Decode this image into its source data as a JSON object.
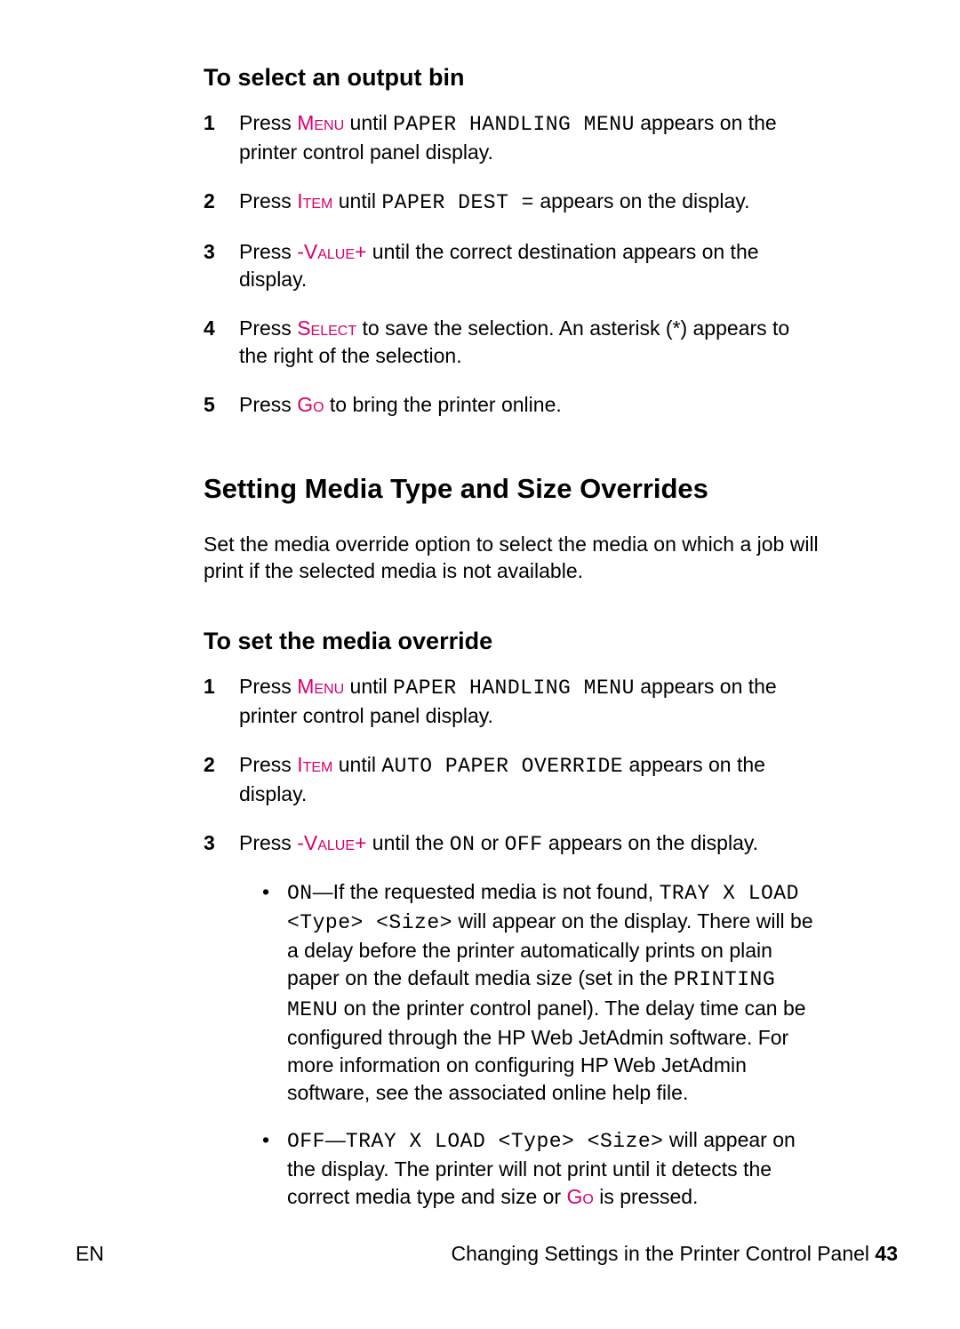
{
  "h_output_bin": "To select an output bin",
  "s1a_pre": "Press ",
  "s1a_key": "Menu",
  "s1a_mid": " until ",
  "s1a_lcd": "PAPER HANDLING MENU",
  "s1a_post": " appears on the printer control panel display.",
  "s2a_pre": "Press ",
  "s2a_key": "Item",
  "s2a_mid": " until ",
  "s2a_lcd": "PAPER DEST =",
  "s2a_post": " appears on the display.",
  "s3a_pre": "Press ",
  "s3a_key": "-Value+",
  "s3a_post": " until the correct destination appears on the display.",
  "s4a_pre": "Press ",
  "s4a_key": "Select",
  "s4a_post": " to save the selection. An asterisk (*) appears to the right of the selection.",
  "s5a_pre": "Press ",
  "s5a_key": "Go",
  "s5a_post": " to bring the printer online.",
  "h_section": "Setting Media Type and Size Overrides",
  "intro": "Set the media override option to select the media on which a job will print if the selected media is not available.",
  "h_override": "To set the media override",
  "s1b_pre": "Press ",
  "s1b_key": "Menu",
  "s1b_mid": " until ",
  "s1b_lcd": "PAPER HANDLING MENU",
  "s1b_post": " appears on the printer control panel display.",
  "s2b_pre": "Press ",
  "s2b_key": "Item",
  "s2b_mid": " until ",
  "s2b_lcd": "AUTO PAPER OVERRIDE",
  "s2b_post": " appears on the display.",
  "s3b_pre": "Press ",
  "s3b_key": "-Value+",
  "s3b_mid": " until the ",
  "s3b_on": "ON",
  "s3b_or": " or ",
  "s3b_off": "OFF",
  "s3b_post": " appears on the display.",
  "b1_on": "ON",
  "b1_a": "—If the requested media is not found, ",
  "b1_lcd1": "TRAY X LOAD <Type> <Size>",
  "b1_b": " will appear on the display. There will be a delay before the printer automatically prints on plain paper on the default media size (set in the ",
  "b1_lcd2": "PRINTING MENU",
  "b1_c": " on the printer control panel). The delay time can be configured through the HP Web JetAdmin software. For more information on configuring HP Web  JetAdmin software, see the associated online help file.",
  "b2_off": "OFF",
  "b2_a": "—",
  "b2_lcd": "TRAY X LOAD <Type> <Size>",
  "b2_b": " will appear on the display. The printer will not print until it detects the correct media type and size or ",
  "b2_key": "Go",
  "b2_c": " is pressed.",
  "footer_left": "EN",
  "footer_right_text": "Changing Settings in the Printer Control Panel ",
  "footer_right_page": "43"
}
